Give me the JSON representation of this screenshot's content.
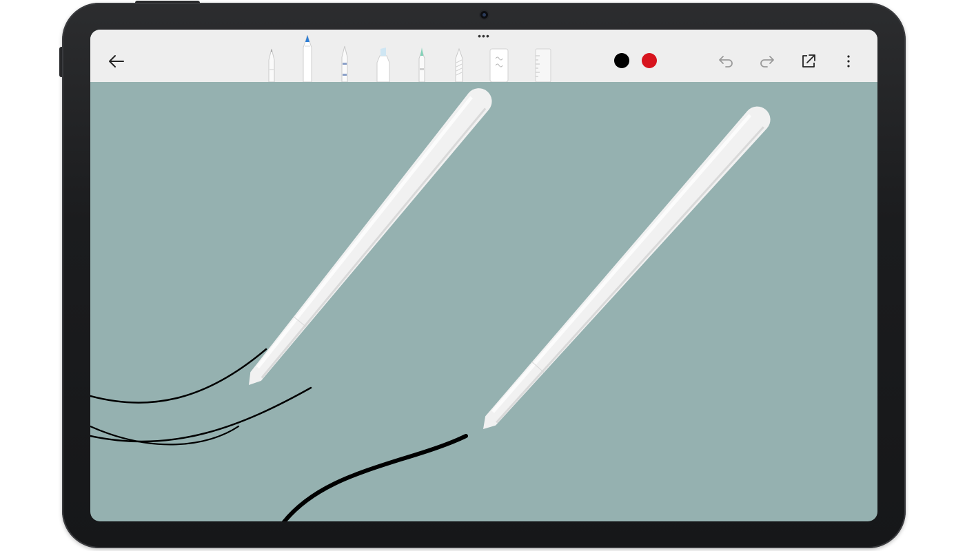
{
  "device": {
    "type": "tablet"
  },
  "toolbar": {
    "back": {
      "icon": "arrow-left-icon"
    },
    "tools": [
      {
        "name": "pencil",
        "icon": "pencil-tool-icon",
        "tip": "#9a9a9a"
      },
      {
        "name": "fountain-pen",
        "icon": "fountain-pen-tool-icon",
        "tip": "#2f7fd6",
        "selected": true
      },
      {
        "name": "ballpoint-pen",
        "icon": "ballpoint-pen-tool-icon",
        "tip": "#9a9a9a"
      },
      {
        "name": "highlighter",
        "icon": "highlighter-tool-icon",
        "tip": "#cfe6f3"
      },
      {
        "name": "brush",
        "icon": "brush-tool-icon",
        "tip": "#7fd3b8"
      },
      {
        "name": "crayon",
        "icon": "crayon-tool-icon",
        "tip": "#bcbcbc"
      },
      {
        "name": "eraser",
        "icon": "eraser-tool-icon",
        "tip": "#e6e6e6"
      },
      {
        "name": "ruler",
        "icon": "ruler-tool-icon",
        "tip": "#e6e6e6"
      }
    ],
    "colors": [
      {
        "name": "black",
        "hex": "#000000"
      },
      {
        "name": "red",
        "hex": "#d7141e"
      }
    ],
    "actions": [
      {
        "name": "undo",
        "icon": "undo-icon"
      },
      {
        "name": "redo",
        "icon": "redo-icon"
      },
      {
        "name": "share",
        "icon": "share-icon"
      },
      {
        "name": "more",
        "icon": "more-vertical-icon"
      }
    ]
  },
  "canvas": {
    "background": "#95b1b0",
    "ink": "#000000"
  },
  "stylus": {
    "color": "#f2f2f2",
    "count": 2
  }
}
